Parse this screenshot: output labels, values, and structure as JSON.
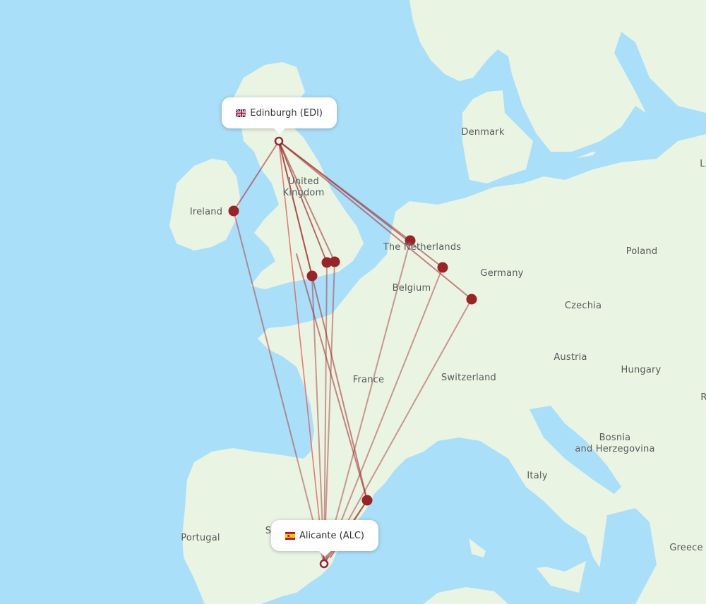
{
  "map": {
    "colors": {
      "water": "#aadff9",
      "land": "#eaf4e2",
      "border": "#8fcb8a",
      "route": "#a0262b",
      "route_highlight": "#e8524f",
      "marker_fill": "#9b2226"
    },
    "origin": {
      "city": "Edinburgh",
      "code": "EDI",
      "label": "Edinburgh (EDI)",
      "country_flag": "uk-flag-icon"
    },
    "destination": {
      "city": "Alicante",
      "code": "ALC",
      "label": "Alicante (ALC)",
      "country_flag": "spain-flag-icon"
    },
    "country_labels": [
      {
        "id": "denmark",
        "text": "Denmark"
      },
      {
        "id": "united-kingdom",
        "text": "United\nKingdom"
      },
      {
        "id": "ireland",
        "text": "Ireland"
      },
      {
        "id": "the-netherlands",
        "text": "The Netherlands"
      },
      {
        "id": "poland",
        "text": "Poland"
      },
      {
        "id": "germany",
        "text": "Germany"
      },
      {
        "id": "belgium",
        "text": "Belgium"
      },
      {
        "id": "czechia",
        "text": "Czechia"
      },
      {
        "id": "france",
        "text": "France"
      },
      {
        "id": "austria",
        "text": "Austria"
      },
      {
        "id": "switzerland",
        "text": "Switzerland"
      },
      {
        "id": "hungary",
        "text": "Hungary"
      },
      {
        "id": "bosnia",
        "text": "Bosnia\nand Herzegovina"
      },
      {
        "id": "italy",
        "text": "Italy"
      },
      {
        "id": "portugal",
        "text": "Portugal"
      },
      {
        "id": "spain",
        "text": "S"
      },
      {
        "id": "greece",
        "text": "Greece"
      },
      {
        "id": "lithuania",
        "text": "L"
      },
      {
        "id": "romania",
        "text": "R"
      }
    ],
    "stopovers": [
      {
        "id": "dublin",
        "name": "Ireland stop"
      },
      {
        "id": "bristol",
        "name": "UK south-west stop"
      },
      {
        "id": "london-1",
        "name": "London stop 1"
      },
      {
        "id": "london-2",
        "name": "London stop 2"
      },
      {
        "id": "amsterdam",
        "name": "Netherlands stop"
      },
      {
        "id": "dusseldorf",
        "name": "Germany west stop"
      },
      {
        "id": "frankfurt",
        "name": "Germany stop"
      },
      {
        "id": "barcelona",
        "name": "Spain east stop"
      }
    ]
  }
}
